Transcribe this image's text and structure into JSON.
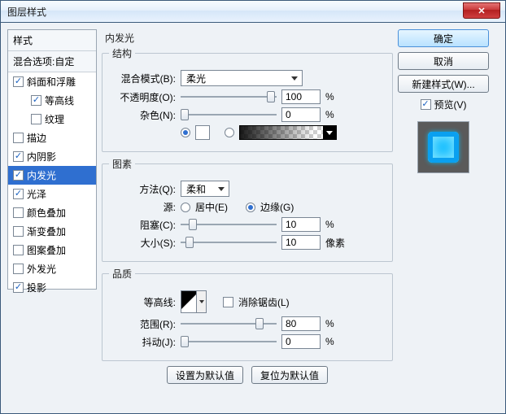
{
  "window": {
    "title": "图层样式"
  },
  "sidebar": {
    "header": "样式",
    "blend_options": "混合选项:自定",
    "items": [
      {
        "label": "斜面和浮雕",
        "checked": true,
        "indent": false
      },
      {
        "label": "等高线",
        "checked": true,
        "indent": true
      },
      {
        "label": "纹理",
        "checked": false,
        "indent": true
      },
      {
        "label": "描边",
        "checked": false,
        "indent": false
      },
      {
        "label": "内阴影",
        "checked": true,
        "indent": false
      },
      {
        "label": "内发光",
        "checked": true,
        "indent": false,
        "selected": true
      },
      {
        "label": "光泽",
        "checked": true,
        "indent": false
      },
      {
        "label": "颜色叠加",
        "checked": false,
        "indent": false
      },
      {
        "label": "渐变叠加",
        "checked": false,
        "indent": false
      },
      {
        "label": "图案叠加",
        "checked": false,
        "indent": false
      },
      {
        "label": "外发光",
        "checked": false,
        "indent": false
      },
      {
        "label": "投影",
        "checked": true,
        "indent": false
      }
    ]
  },
  "panel": {
    "title": "内发光",
    "structure": {
      "legend": "结构",
      "blend_mode_label": "混合模式(B):",
      "blend_mode_value": "柔光",
      "opacity_label": "不透明度(O):",
      "opacity_value": "100",
      "opacity_unit": "%",
      "noise_label": "杂色(N):",
      "noise_value": "0",
      "noise_unit": "%"
    },
    "elements": {
      "legend": "图素",
      "technique_label": "方法(Q):",
      "technique_value": "柔和",
      "source_label": "源:",
      "source_center": "居中(E)",
      "source_edge": "边缘(G)",
      "choke_label": "阻塞(C):",
      "choke_value": "10",
      "choke_unit": "%",
      "size_label": "大小(S):",
      "size_value": "10",
      "size_unit": "像素"
    },
    "quality": {
      "legend": "品质",
      "contour_label": "等高线:",
      "antialias_label": "消除锯齿(L)",
      "range_label": "范围(R):",
      "range_value": "80",
      "range_unit": "%",
      "jitter_label": "抖动(J):",
      "jitter_value": "0",
      "jitter_unit": "%"
    },
    "buttons": {
      "make_default": "设置为默认值",
      "reset_default": "复位为默认值"
    }
  },
  "right": {
    "ok": "确定",
    "cancel": "取消",
    "new_style": "新建样式(W)...",
    "preview_label": "预览(V)"
  }
}
